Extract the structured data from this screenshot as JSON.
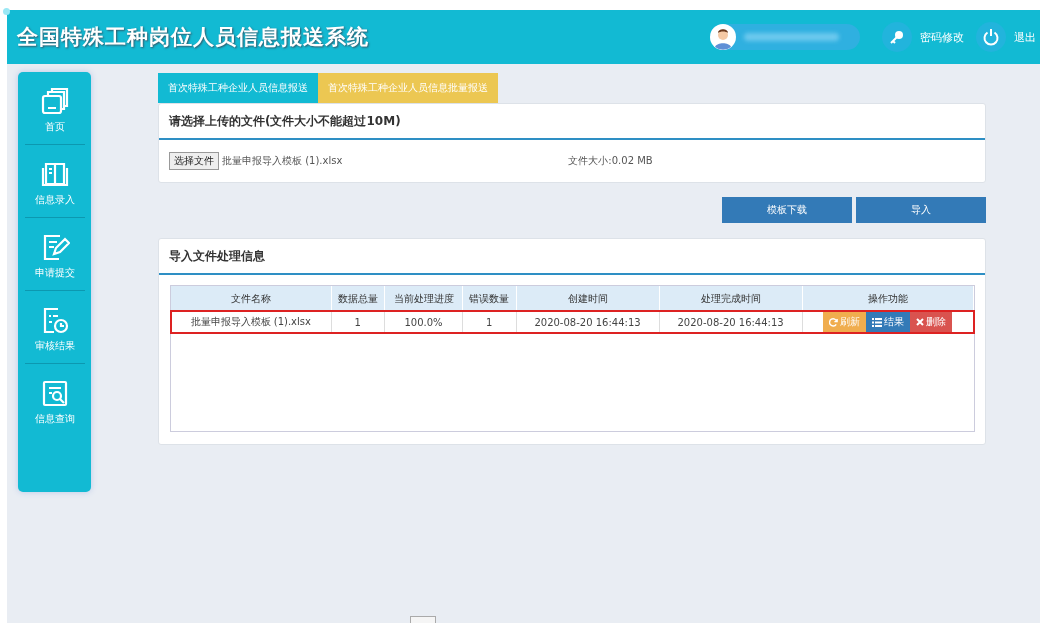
{
  "header": {
    "title": "全国特殊工种岗位人员信息报送系统",
    "actions": [
      {
        "kind": "key",
        "label": "密码修改"
      },
      {
        "kind": "power",
        "label": "退出"
      }
    ]
  },
  "sidebar": {
    "items": [
      {
        "kind": "home",
        "label": "首页"
      },
      {
        "kind": "book",
        "label": "信息录入"
      },
      {
        "kind": "edit",
        "label": "申请提交"
      },
      {
        "kind": "clock",
        "label": "审核结果"
      },
      {
        "kind": "search",
        "label": "信息查询"
      }
    ]
  },
  "tabs": [
    {
      "label": "首次特殊工种企业人员信息报送",
      "selected": false
    },
    {
      "label": "首次特殊工种企业人员信息批量报送",
      "selected": true
    }
  ],
  "upload": {
    "title": "请选择上传的文件(文件大小不能超过10M)",
    "choose_button": "选择文件",
    "file_name": "批量申报导入模板 (1).xlsx",
    "file_size": "文件大小:0.02 MB"
  },
  "buttons": [
    "模板下载",
    "导入"
  ],
  "results": {
    "title": "导入文件处理信息",
    "columns": [
      "文件名称",
      "数据总量",
      "当前处理进度",
      "错误数量",
      "创建时间",
      "处理完成时间",
      "操作功能"
    ],
    "rows": [
      {
        "cells": [
          "批量申报导入模板 (1).xlsx",
          "1",
          "100.0%",
          "1",
          "2020-08-20 16:44:13",
          "2020-08-20 16:44:13"
        ],
        "highlighted": true,
        "actions": [
          {
            "kind": "refresh",
            "label": "刷新"
          },
          {
            "kind": "list",
            "label": "结果"
          },
          {
            "kind": "delete",
            "label": "删除"
          }
        ]
      }
    ]
  }
}
